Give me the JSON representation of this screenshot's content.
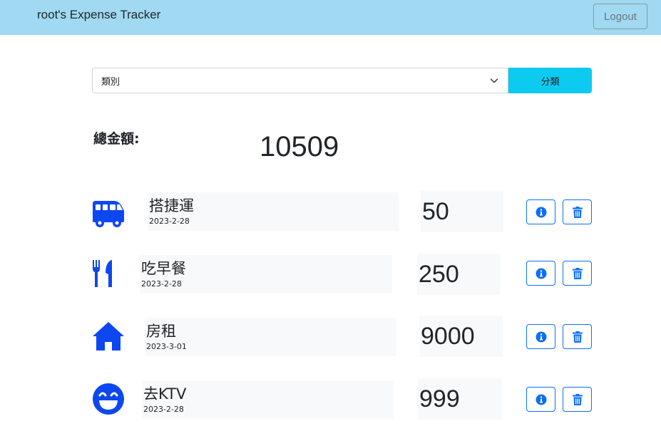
{
  "navbar": {
    "title": "root's Expense Tracker",
    "logout_label": "Logout"
  },
  "filter": {
    "select_value": "類別",
    "sort_label": "分類"
  },
  "total": {
    "label": "總金額:",
    "value": "10509"
  },
  "records": [
    {
      "icon": "bus-icon",
      "name": "搭捷運",
      "date": "2023-2-28",
      "amount": "50"
    },
    {
      "icon": "utensils-icon",
      "name": "吃早餐",
      "date": "2023-2-28",
      "amount": "250"
    },
    {
      "icon": "home-icon",
      "name": "房租",
      "date": "2023-3-01",
      "amount": "9000"
    },
    {
      "icon": "smile-icon",
      "name": "去KTV",
      "date": "2023-2-28",
      "amount": "999"
    }
  ],
  "colors": {
    "navbar_bg": "#a0d9f1",
    "accent_blue": "#0d6efd",
    "sort_button": "#0dcaf0"
  }
}
